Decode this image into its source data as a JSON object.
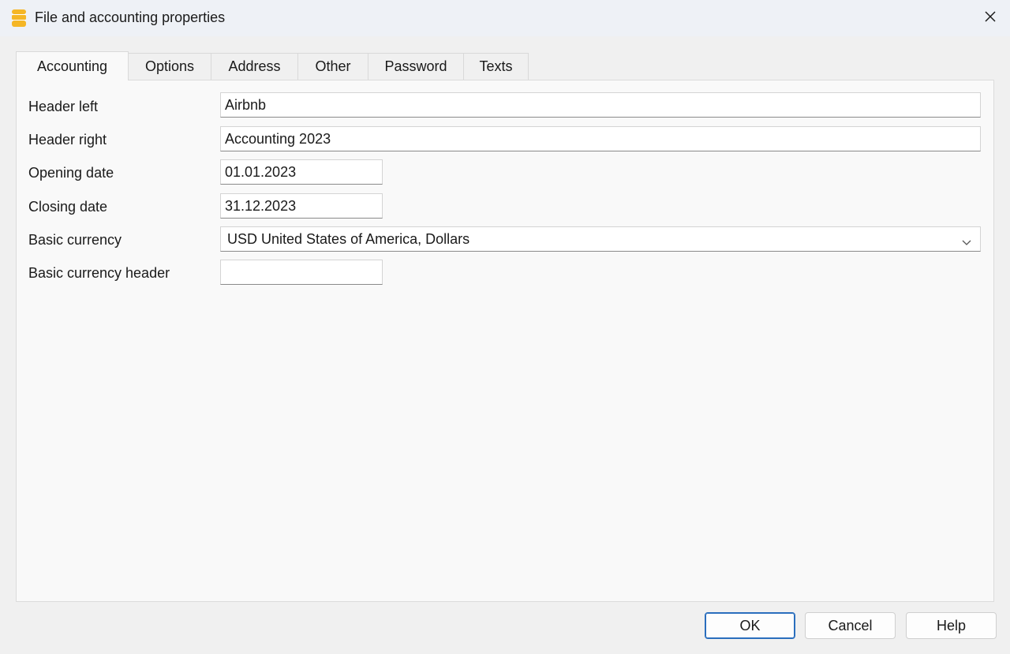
{
  "window": {
    "title": "File and accounting properties"
  },
  "icons": {
    "app": "ledger-stack-icon",
    "close": "close-icon",
    "dropdown": "chevron-down-icon"
  },
  "colors": {
    "app_icon": "#f5b625",
    "default_button_border": "#2a6ebd"
  },
  "tabs": [
    {
      "label": "Accounting",
      "active": true
    },
    {
      "label": "Options",
      "active": false
    },
    {
      "label": "Address",
      "active": false
    },
    {
      "label": "Other",
      "active": false
    },
    {
      "label": "Password",
      "active": false
    },
    {
      "label": "Texts",
      "active": false
    }
  ],
  "form": {
    "header_left": {
      "label": "Header left",
      "value": "Airbnb"
    },
    "header_right": {
      "label": "Header right",
      "value": "Accounting 2023"
    },
    "opening_date": {
      "label": "Opening date",
      "value": "01.01.2023"
    },
    "closing_date": {
      "label": "Closing date",
      "value": "31.12.2023"
    },
    "basic_currency": {
      "label": "Basic currency",
      "value": "USD United States of America, Dollars"
    },
    "basic_currency_header": {
      "label": "Basic currency header",
      "value": ""
    }
  },
  "buttons": {
    "ok": "OK",
    "cancel": "Cancel",
    "help": "Help"
  }
}
